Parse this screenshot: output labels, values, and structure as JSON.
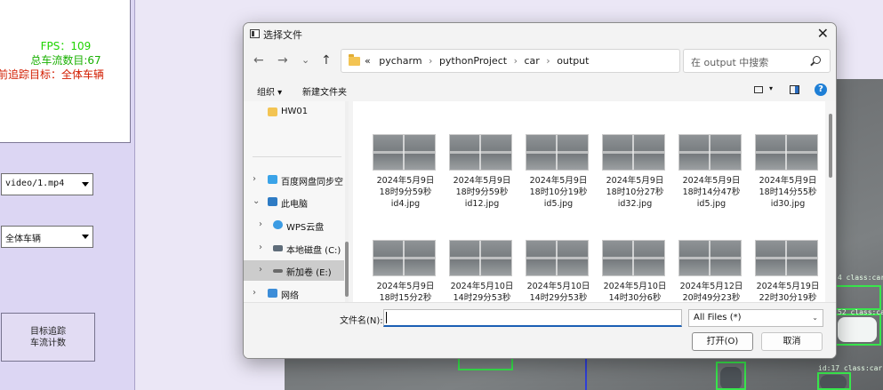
{
  "app": {
    "fps_text": "FPS：109",
    "count_text": "总车流数目:67",
    "target_text": "前追踪目标：全体车辆",
    "video_combo": "video/1.mp4",
    "class_combo": "全体车辆",
    "track_button_line1": "目标追踪",
    "track_button_line2": "车流计数",
    "detection_labels": [
      "4 class:car",
      "52 class:car",
      "id:17 class:car"
    ]
  },
  "dialog": {
    "title": "选择文件",
    "close": "✕",
    "nav": {
      "back": "←",
      "forward": "→",
      "recent": "⌄",
      "up": "↑"
    },
    "address": {
      "prefix": "«",
      "crumbs": [
        "pycharm",
        "pythonProject",
        "car",
        "output"
      ],
      "separator": "›",
      "dropdown": "⌄",
      "refresh": "↻"
    },
    "search_placeholder": "在 output 中搜索",
    "toolbar": {
      "organize": "组织 ▾",
      "new_folder": "新建文件夹",
      "view_chev": "▾",
      "help": "?"
    },
    "nav_pane": [
      {
        "label": "HW01",
        "icon": "folder-icon",
        "chevron": ""
      },
      {
        "label": "百度网盘同步空",
        "icon": "baidu-netdisk-icon",
        "chevron": "›"
      },
      {
        "label": "此电脑",
        "icon": "computer-icon",
        "chevron": "⌄"
      },
      {
        "label": "WPS云盘",
        "icon": "cloud-icon",
        "chevron": "›"
      },
      {
        "label": "本地磁盘 (C:)",
        "icon": "drive-icon",
        "chevron": "›"
      },
      {
        "label": "新加卷 (E:)",
        "icon": "drive-icon",
        "chevron": "›",
        "selected": true
      },
      {
        "label": "网络",
        "icon": "network-icon",
        "chevron": "›"
      }
    ],
    "files": [
      {
        "line1": "2024年5月9日",
        "line2": "18时9分59秒",
        "line3": "id4.jpg"
      },
      {
        "line1": "2024年5月9日",
        "line2": "18时9分59秒",
        "line3": "id12.jpg"
      },
      {
        "line1": "2024年5月9日",
        "line2": "18时10分19秒",
        "line3": "id5.jpg"
      },
      {
        "line1": "2024年5月9日",
        "line2": "18时10分27秒",
        "line3": "id32.jpg"
      },
      {
        "line1": "2024年5月9日",
        "line2": "18时14分47秒",
        "line3": "id5.jpg"
      },
      {
        "line1": "2024年5月9日",
        "line2": "18时14分55秒",
        "line3": "id30.jpg"
      },
      {
        "line1": "2024年5月9日",
        "line2": "18时15分2秒",
        "line3": ""
      },
      {
        "line1": "2024年5月10日",
        "line2": "14时29分53秒",
        "line3": ""
      },
      {
        "line1": "2024年5月10日",
        "line2": "14时29分53秒",
        "line3": ""
      },
      {
        "line1": "2024年5月10日",
        "line2": "14时30分6秒",
        "line3": ""
      },
      {
        "line1": "2024年5月12日",
        "line2": "20时49分23秒",
        "line3": ""
      },
      {
        "line1": "2024年5月19日",
        "line2": "22时30分19秒",
        "line3": ""
      }
    ],
    "filename_label": "文件名(N):",
    "filename_value": "",
    "filter_value": "All Files (*)",
    "combo_chev": "⌄",
    "open_button": "打开(O)",
    "cancel_button": "取消"
  },
  "colors": {
    "fps": "#1fd400",
    "count": "#18b000",
    "target": "#d21d00",
    "accent": "#1a5fb4",
    "bbox": "#38e64c"
  }
}
